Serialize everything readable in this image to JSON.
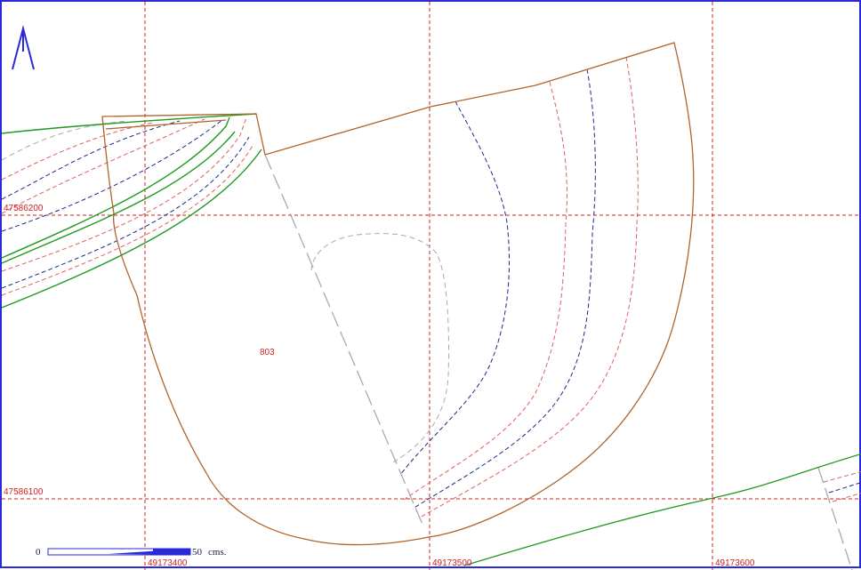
{
  "map": {
    "grid_easting_labels": [
      "49173400",
      "49173500",
      "49173600"
    ],
    "grid_northing_labels": [
      "47586200",
      "47586100"
    ],
    "parcel_label": "803",
    "north_arrow": "north-arrow-icon",
    "scale_bar": {
      "start_label": "0",
      "end_label": "50",
      "unit_label": "cms."
    },
    "colors": {
      "frame": "#2a2ad8",
      "grid": "#cc2222",
      "boundary": "#b0642a",
      "green_line": "#1f9a1f",
      "contour_blue": "#1a2a8a",
      "contour_red": "#e06060",
      "contour_gray": "#aaaaaa"
    }
  }
}
